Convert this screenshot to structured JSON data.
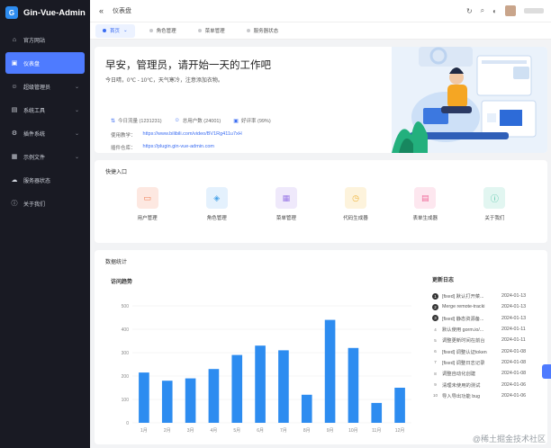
{
  "brand": {
    "name": "Gin-Vue-Admin",
    "logo_icon": "gva-logo"
  },
  "sidebar": {
    "items": [
      {
        "label": "官方网站",
        "icon": "home-icon",
        "active": false,
        "has_children": false
      },
      {
        "label": "仪表盘",
        "icon": "dashboard-icon",
        "active": true,
        "has_children": false
      },
      {
        "label": "超级管理员",
        "icon": "user-icon",
        "active": false,
        "has_children": true
      },
      {
        "label": "系统工具",
        "icon": "toolbox-icon",
        "active": false,
        "has_children": true
      },
      {
        "label": "插件系统",
        "icon": "plugin-icon",
        "active": false,
        "has_children": true
      },
      {
        "label": "示例文件",
        "icon": "file-icon",
        "active": false,
        "has_children": true
      },
      {
        "label": "服务器状态",
        "icon": "cloud-icon",
        "active": false,
        "has_children": false
      },
      {
        "label": "关于我们",
        "icon": "info-icon",
        "active": false,
        "has_children": false
      }
    ]
  },
  "topbar": {
    "breadcrumb": "仪表盘",
    "collapse_icon": "«"
  },
  "tabs": [
    {
      "label": "首页",
      "active": true
    },
    {
      "label": "角色管理",
      "active": false
    },
    {
      "label": "菜单管理",
      "active": false
    },
    {
      "label": "服务器状态",
      "active": false
    }
  ],
  "greeting": {
    "title": "早安，管理员，请开始一天的工作吧",
    "weather": "今日晴，0℃ - 10℃，天气寒冷，注意添加衣物。",
    "stats": [
      {
        "label": "今日流量 (1231231)",
        "icon": "traffic-icon"
      },
      {
        "label": "总用户数 (24001)",
        "icon": "users-icon"
      },
      {
        "label": "好评率 (99%)",
        "icon": "comment-icon"
      }
    ],
    "video_label": "使用教学：",
    "video_url": "https://www.bilibili.com/video/BV1Rg411u7xH",
    "plugin_label": "插件仓库：",
    "plugin_url": "https://plugin.gin-vue-admin.com"
  },
  "quick": {
    "title": "快捷入口",
    "items": [
      {
        "label": "用户管理",
        "icon": "monitor-icon",
        "bg": "#fde8e1",
        "fg": "#f07b52"
      },
      {
        "label": "角色管理",
        "icon": "cube-icon",
        "bg": "#e4f1fd",
        "fg": "#4aa3e8"
      },
      {
        "label": "菜单管理",
        "icon": "grid-icon",
        "bg": "#efe9fb",
        "fg": "#9b7be6"
      },
      {
        "label": "代码生成器",
        "icon": "clock-icon",
        "bg": "#fdf3dc",
        "fg": "#f0b43c"
      },
      {
        "label": "表单生成器",
        "icon": "doc-icon",
        "bg": "#fde7ef",
        "fg": "#ef6c9b"
      },
      {
        "label": "关于我们",
        "icon": "info-icon",
        "bg": "#e2f6f1",
        "fg": "#3fbf9d"
      }
    ]
  },
  "stats_card": {
    "title": "数据统计",
    "chart_title": "访问趋势",
    "changelog_title": "更新日志"
  },
  "chart_data": {
    "type": "bar",
    "title": "访问趋势",
    "categories": [
      "1月",
      "2月",
      "3月",
      "4月",
      "5月",
      "6月",
      "7月",
      "8月",
      "9月",
      "10月",
      "11月",
      "12月"
    ],
    "values": [
      215,
      180,
      190,
      230,
      290,
      330,
      310,
      120,
      440,
      320,
      85,
      150
    ],
    "ylim": [
      0,
      500
    ],
    "yticks": [
      0,
      100,
      200,
      300,
      400,
      500
    ],
    "color": "#2d8cf0",
    "grid": true
  },
  "changelog": [
    {
      "num": "1",
      "text": "[fixed] 默认打开菜...",
      "date": "2024-01-13",
      "badge": true
    },
    {
      "num": "2",
      "text": "Merge remote-tracki",
      "date": "2024-01-13",
      "badge": true
    },
    {
      "num": "3",
      "text": "[fixed] 静态资源备...",
      "date": "2024-01-13",
      "badge": true
    },
    {
      "num": "4",
      "text": "默认使用 gorm.io/...",
      "date": "2024-01-11",
      "badge": false
    },
    {
      "num": "5",
      "text": "调整更新时间在前台",
      "date": "2024-01-11",
      "badge": false
    },
    {
      "num": "6",
      "text": "[fixed] 调整认证token",
      "date": "2024-01-08",
      "badge": false
    },
    {
      "num": "7",
      "text": "[fixed] 调整日志记录",
      "date": "2024-01-08",
      "badge": false
    },
    {
      "num": "8",
      "text": "调整自动化创建",
      "date": "2024-01-08",
      "badge": false
    },
    {
      "num": "9",
      "text": "清理未使用的测试",
      "date": "2024-01-06",
      "badge": false
    },
    {
      "num": "10",
      "text": "导入导出功能 bug",
      "date": "2024-01-06",
      "badge": false
    }
  ],
  "watermark": "@稀土掘金技术社区"
}
